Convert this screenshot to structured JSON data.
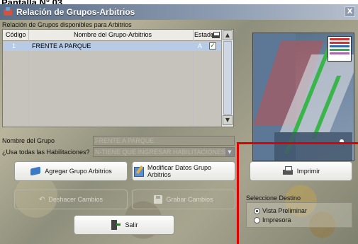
{
  "top_caption": "Pantalla N° 03",
  "window": {
    "title": "Relación de Grupos-Arbitrios",
    "close_glyph": "X"
  },
  "grid": {
    "caption": "Relación de Grupos disponibles para Arbitrios",
    "columns": [
      "Código",
      "Nombre del Grupo-Arbitrios",
      "Estado"
    ],
    "rows": [
      {
        "code": "1",
        "name": "FRENTE A PARQUE",
        "estado": "A",
        "checked": true
      }
    ],
    "scroll_up": "▲",
    "scroll_down": "▼"
  },
  "form": {
    "nombre_label": "Nombre del Grupo",
    "nombre_value": "FRENTE A PARQUE",
    "habilitaciones_label": "¿Usa todas las Habilitaciones?",
    "habilitaciones_value": "N-TIENE QUE INGRESAR HABILITACIONES",
    "dropdown_arrow": "▼"
  },
  "buttons": {
    "agregar": "Agregar Grupo Arbitrios",
    "modificar": "Modificar Datos Grupo Arbitrios",
    "imprimir": "Imprimir",
    "deshacer": "Deshacer Cambios",
    "deshacer_glyph": "↶",
    "grabar": "Grabar Cambios",
    "salir": "Salir"
  },
  "destination": {
    "label": "Seleccione Destino",
    "options": [
      {
        "label": "Vista Preliminar",
        "selected": true
      },
      {
        "label": "Impresora",
        "selected": false
      }
    ]
  },
  "colors": {
    "title_bar": "#5a6d86",
    "selected_row": "#b8cbe6",
    "highlight_box": "#e00000"
  }
}
